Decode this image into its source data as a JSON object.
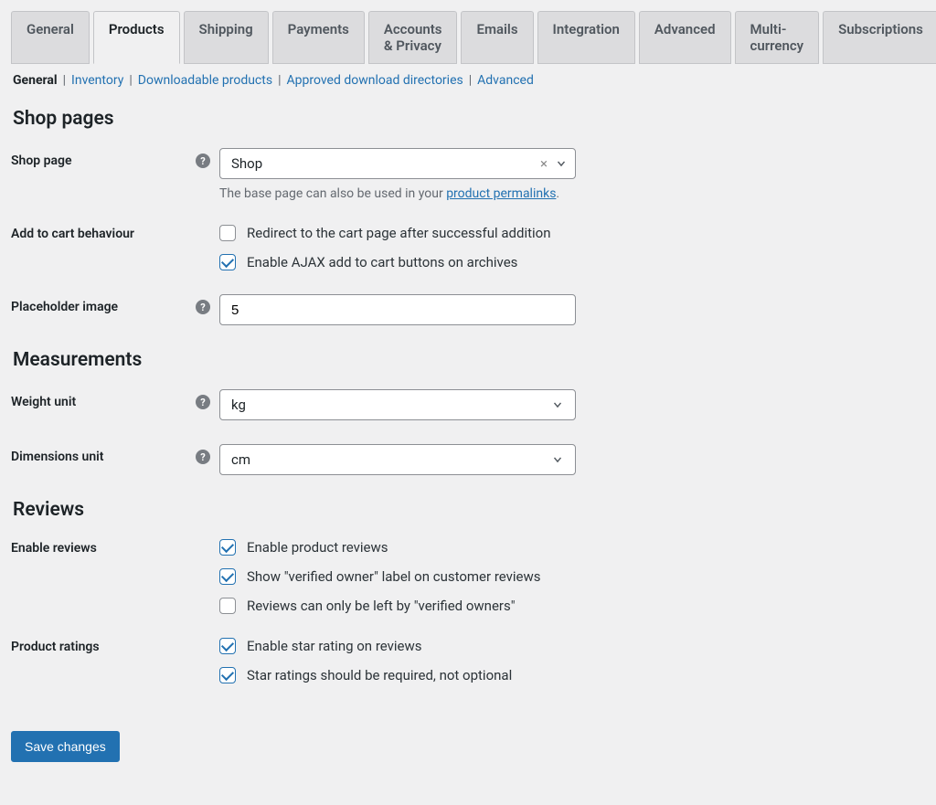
{
  "tabs": {
    "general": "General",
    "products": "Products",
    "shipping": "Shipping",
    "payments": "Payments",
    "accounts_privacy": "Accounts & Privacy",
    "emails": "Emails",
    "integration": "Integration",
    "advanced": "Advanced",
    "multi_currency": "Multi-currency",
    "subscriptions": "Subscriptions"
  },
  "subtabs": {
    "general": "General",
    "inventory": "Inventory",
    "downloadable": "Downloadable products",
    "approved_dirs": "Approved download directories",
    "advanced": "Advanced"
  },
  "sections": {
    "shop_pages": "Shop pages",
    "measurements": "Measurements",
    "reviews": "Reviews"
  },
  "labels": {
    "shop_page": "Shop page",
    "add_to_cart_behaviour": "Add to cart behaviour",
    "placeholder_image": "Placeholder image",
    "weight_unit": "Weight unit",
    "dimensions_unit": "Dimensions unit",
    "enable_reviews": "Enable reviews",
    "product_ratings": "Product ratings"
  },
  "shop_page": {
    "value": "Shop",
    "description_prefix": "The base page can also be used in your ",
    "description_link": "product permalinks",
    "description_suffix": "."
  },
  "add_to_cart": {
    "redirect_label": "Redirect to the cart page after successful addition",
    "redirect_checked": false,
    "ajax_label": "Enable AJAX add to cart buttons on archives",
    "ajax_checked": true
  },
  "placeholder_image": {
    "value": "5"
  },
  "weight_unit": {
    "value": "kg"
  },
  "dimensions_unit": {
    "value": "cm"
  },
  "reviews": {
    "enable_label": "Enable product reviews",
    "enable_checked": true,
    "verified_label_label": "Show \"verified owner\" label on customer reviews",
    "verified_label_checked": true,
    "verified_only_label": "Reviews can only be left by \"verified owners\"",
    "verified_only_checked": false
  },
  "ratings": {
    "enable_star_label": "Enable star rating on reviews",
    "enable_star_checked": true,
    "require_star_label": "Star ratings should be required, not optional",
    "require_star_checked": true
  },
  "save_button": "Save changes"
}
